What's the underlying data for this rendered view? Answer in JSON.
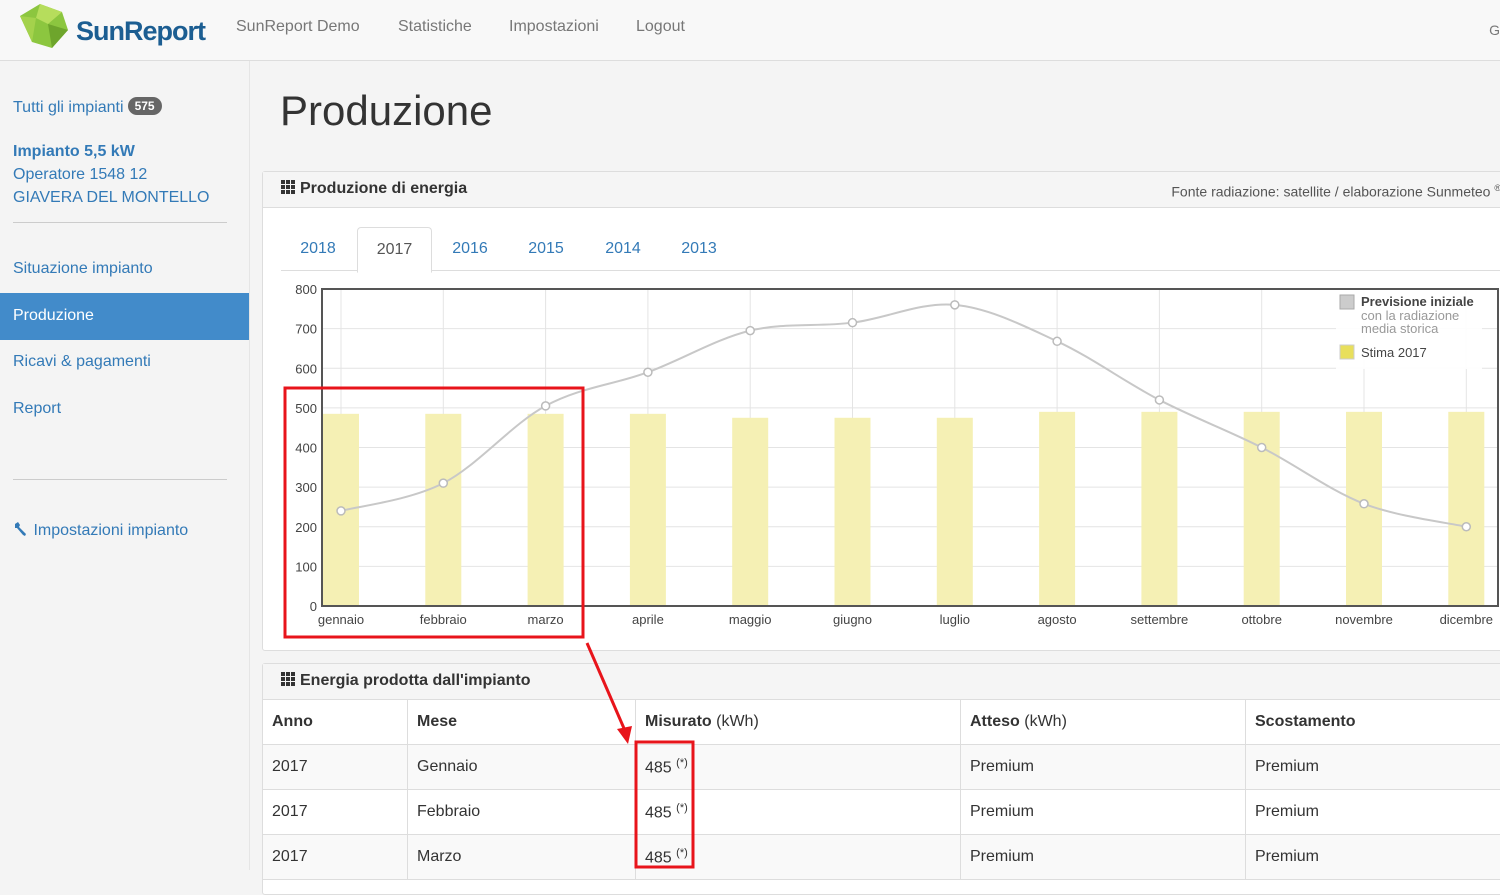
{
  "brand": {
    "name_part1": "Sun",
    "name_part2": "Report"
  },
  "nav": {
    "items": [
      "SunReport Demo",
      "Statistiche",
      "Impostazioni",
      "Logout"
    ],
    "user_fragment": "G"
  },
  "sidebar": {
    "all_plants_label": "Tutti gli impianti",
    "all_plants_count": "575",
    "plant_name": "Impianto 5,5 kW",
    "operator": "Operatore 1548 12",
    "location": "GIAVERA DEL MONTELLO",
    "menu": [
      "Situazione impianto",
      "Produzione",
      "Ricavi & pagamenti",
      "Report"
    ],
    "active_index": 1,
    "settings_label": "Impostazioni impianto"
  },
  "page": {
    "title": "Produzione"
  },
  "energy_panel": {
    "title": "Produzione di energia",
    "source_note": "Fonte radiazione: satellite / elaborazione Sunmeteo",
    "source_mark": "®",
    "tabs": [
      "2018",
      "2017",
      "2016",
      "2015",
      "2014",
      "2013"
    ],
    "active_tab": "2017"
  },
  "chart_data": {
    "type": "bar",
    "categories": [
      "gennaio",
      "febbraio",
      "marzo",
      "aprile",
      "maggio",
      "giugno",
      "luglio",
      "agosto",
      "settembre",
      "ottobre",
      "novembre",
      "dicembre"
    ],
    "series": [
      {
        "name": "Stima 2017",
        "kind": "bar",
        "color": "#f5f0b4",
        "values": [
          485,
          485,
          485,
          485,
          475,
          475,
          475,
          490,
          490,
          490,
          490,
          490
        ]
      },
      {
        "name": "Previsione iniziale",
        "kind": "line",
        "color": "#c8c8c8",
        "values": [
          240,
          310,
          505,
          590,
          695,
          715,
          760,
          668,
          520,
          400,
          258,
          200
        ]
      }
    ],
    "ylim": [
      0,
      800
    ],
    "yticks": [
      0,
      100,
      200,
      300,
      400,
      500,
      600,
      700,
      800
    ],
    "grid": true,
    "legend_position": "top-right",
    "legend": [
      {
        "label": "Previsione iniziale",
        "sublabel_1": "con la radiazione",
        "sublabel_2": "media storica",
        "color": "#cccccc"
      },
      {
        "label": "Stima 2017",
        "color": "#e8df5c"
      }
    ]
  },
  "table_panel": {
    "title": "Energia prodotta dall'impianto",
    "headers": [
      {
        "label": "Anno",
        "unit": ""
      },
      {
        "label": "Mese",
        "unit": ""
      },
      {
        "label": "Misurato",
        "unit": "(kWh)"
      },
      {
        "label": "Atteso",
        "unit": "(kWh)"
      },
      {
        "label": "Scostamento",
        "unit": ""
      }
    ],
    "rows": [
      {
        "year": "2017",
        "month": "Gennaio",
        "measured": "485",
        "mark": "(*)",
        "expected": "Premium",
        "deviation": "Premium"
      },
      {
        "year": "2017",
        "month": "Febbraio",
        "measured": "485",
        "mark": "(*)",
        "expected": "Premium",
        "deviation": "Premium"
      },
      {
        "year": "2017",
        "month": "Marzo",
        "measured": "485",
        "mark": "(*)",
        "expected": "Premium",
        "deviation": "Premium"
      }
    ]
  },
  "colors": {
    "highlight": "#e8141b",
    "accent": "#428bca",
    "link": "#337ab7"
  }
}
